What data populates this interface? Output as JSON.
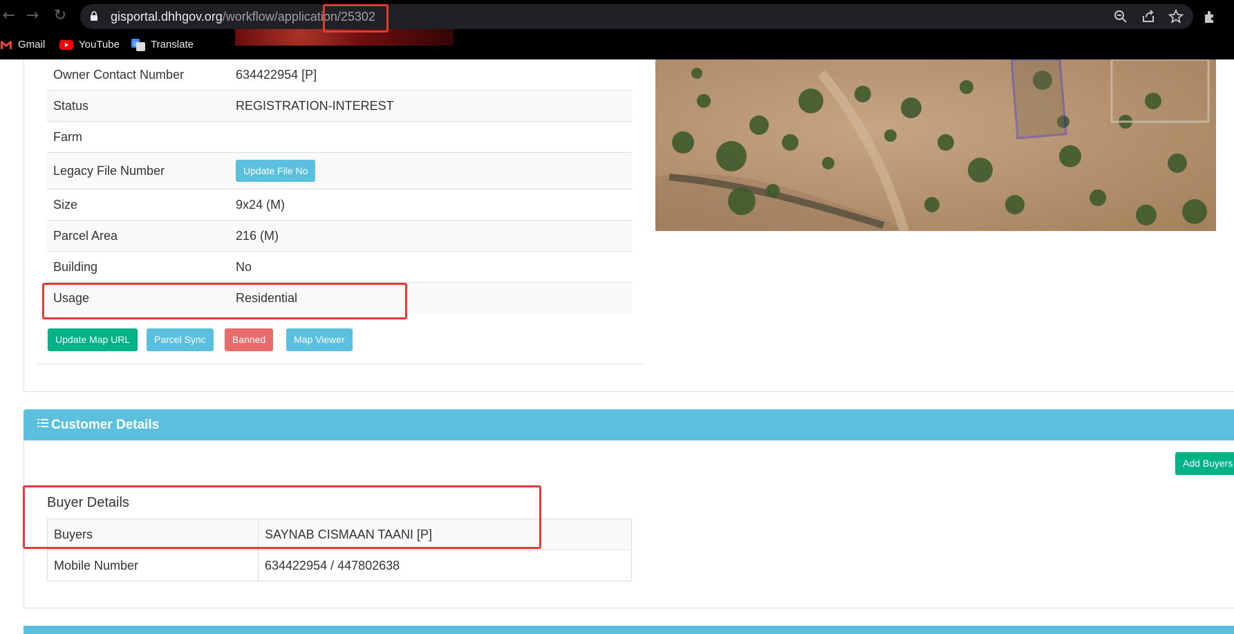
{
  "browser": {
    "url_host": "gisportal.dhhgov.org",
    "url_path": "/workflow/application/25302",
    "bookmarks": [
      {
        "label": "Gmail",
        "icon": "gmail-icon"
      },
      {
        "label": "YouTube",
        "icon": "youtube-icon"
      },
      {
        "label": "Translate",
        "icon": "translate-icon"
      }
    ]
  },
  "details": {
    "rows": [
      {
        "label": "Owner Contact Number",
        "value": "634422954 [P]"
      },
      {
        "label": "Status",
        "value": "REGISTRATION-INTEREST"
      },
      {
        "label": "Farm",
        "value": ""
      },
      {
        "label": "Legacy File Number",
        "button": "Update File No"
      },
      {
        "label": "Size",
        "value": "9x24 (M)"
      },
      {
        "label": "Parcel Area",
        "value": "216 (M)"
      },
      {
        "label": "Building",
        "value": "No"
      },
      {
        "label": "Usage",
        "value": "Residential"
      }
    ],
    "actions": {
      "update_map_url": "Update Map URL",
      "parcel_sync": "Parcel Sync",
      "banned": "Banned",
      "map_viewer": "Map Viewer"
    }
  },
  "customer": {
    "section_title": "Customer Details",
    "add_buyers": "Add Buyers",
    "buyer_details_title": "Buyer Details",
    "rows": [
      {
        "label": "Buyers",
        "value": "SAYNAB CISMAAN TAANI [P]"
      },
      {
        "label": "Mobile Number",
        "value": "634422954 / 447802638"
      }
    ]
  },
  "colors": {
    "info": "#5bc0de",
    "success": "#00b386",
    "danger": "#e96b6b",
    "highlight": "#e53935"
  }
}
